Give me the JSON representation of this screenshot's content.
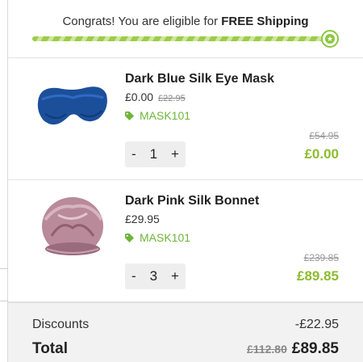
{
  "shipping": {
    "message_prefix": "Congrats! You are eligible for ",
    "message_bold": "FREE Shipping",
    "progress": 1.0
  },
  "items": [
    {
      "name": "Dark Blue Silk Eye Mask",
      "price": "£0.00",
      "was_price": "£22.95",
      "discount_code": "MASK101",
      "qty_minus": "-",
      "quantity": "1",
      "qty_plus": "+",
      "line_original": "£54.95",
      "line_total": "£0.00",
      "image": "eye-mask"
    },
    {
      "name": "Dark Pink Silk Bonnet",
      "price": "£29.95",
      "discount_code": "MASK101",
      "qty_minus": "-",
      "quantity": "3",
      "qty_plus": "+",
      "line_original": "£239.85",
      "line_total": "£89.85",
      "image": "bonnet"
    }
  ],
  "summary": {
    "discounts_label": "Discounts",
    "discounts_value": "-£22.95",
    "total_label": "Total",
    "total_original": "£112.80",
    "total_value": "£89.85"
  },
  "colors": {
    "accent_green": "#8cbd2f",
    "tag_green": "#6fb53a",
    "summary_bg": "#f2f2f2"
  }
}
